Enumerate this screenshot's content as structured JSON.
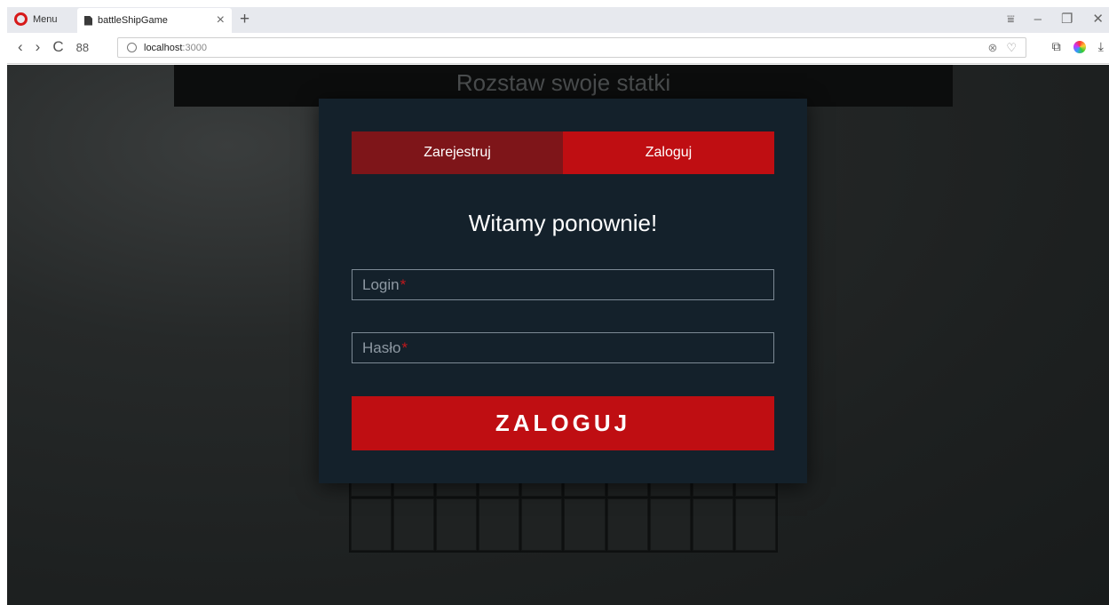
{
  "browser": {
    "menu_label": "Menu",
    "tab_title": "battleShipGame",
    "tab_close": "×",
    "new_tab": "+",
    "url_host": "localhost",
    "url_port": ":3000",
    "nav": {
      "back": "‹",
      "forward": "›",
      "reload": "C",
      "speed_dial": "88"
    }
  },
  "page": {
    "banner_title": "Rozstaw swoje statki"
  },
  "modal": {
    "tabs": [
      {
        "label": "Zarejestruj",
        "active": false
      },
      {
        "label": "Zaloguj",
        "active": true
      }
    ],
    "welcome": "Witamy ponownie!",
    "login_placeholder": "Login",
    "password_placeholder": "Hasło",
    "required_mark": "*",
    "submit_label": "ZALOGUJ"
  },
  "colors": {
    "accent": "#bf0e12",
    "tab_inactive": "#7e1519",
    "modal_bg": "#14212b"
  }
}
